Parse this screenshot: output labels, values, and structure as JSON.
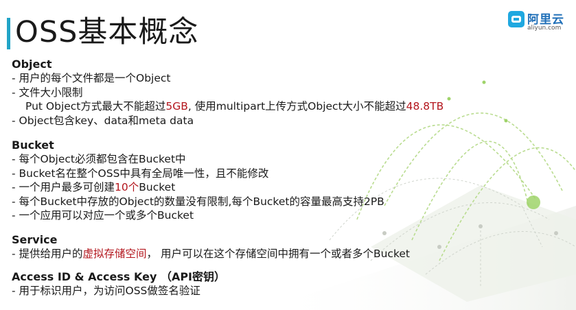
{
  "slide": {
    "title": "OSS基本概念",
    "logo": {
      "name": "阿里云",
      "url": "aliyun.com"
    }
  },
  "sections": {
    "object": {
      "heading": "Object",
      "item1": "- 用户的每个文件都是一个Object",
      "item2": "- 文件大小限制",
      "item3": {
        "part1": "Put Object方式最大不能超过",
        "hl1": "5GB",
        "part2": ", 使用multipart上传方式Object大小不能超过",
        "hl2": "48.8TB"
      },
      "item4": "- Object包含key、data和meta data"
    },
    "bucket": {
      "heading": "Bucket",
      "item1": "- 每个Object必须都包含在Bucket中",
      "item2": "- Bucket名在整个OSS中具有全局唯一性，且不能修改",
      "item3": {
        "part1": "- 一个用户最多可创建",
        "hl": "10个",
        "part2": "Bucket"
      },
      "item4": "- 每个Bucket中存放的Object的数量没有限制,每个Bucket的容量最高支持2PB",
      "item5": "- 一个应用可以对应一个或多个Bucket"
    },
    "service": {
      "heading": "Service",
      "item1": {
        "part1": "- 提供给用户的",
        "hl": "虚拟存储空间",
        "part2": "， 用户可以在这个存储空间中拥有一个或者多个Bucket"
      }
    },
    "access": {
      "heading": "Access ID & Access Key （API密钥）",
      "item1": "- 用于标识用户，为访问OSS做签名验证"
    }
  },
  "colors": {
    "accent": "#21a4c7",
    "highlight": "#b3161d",
    "logo": "#1fa8e0",
    "arc": "#9fd36a"
  }
}
